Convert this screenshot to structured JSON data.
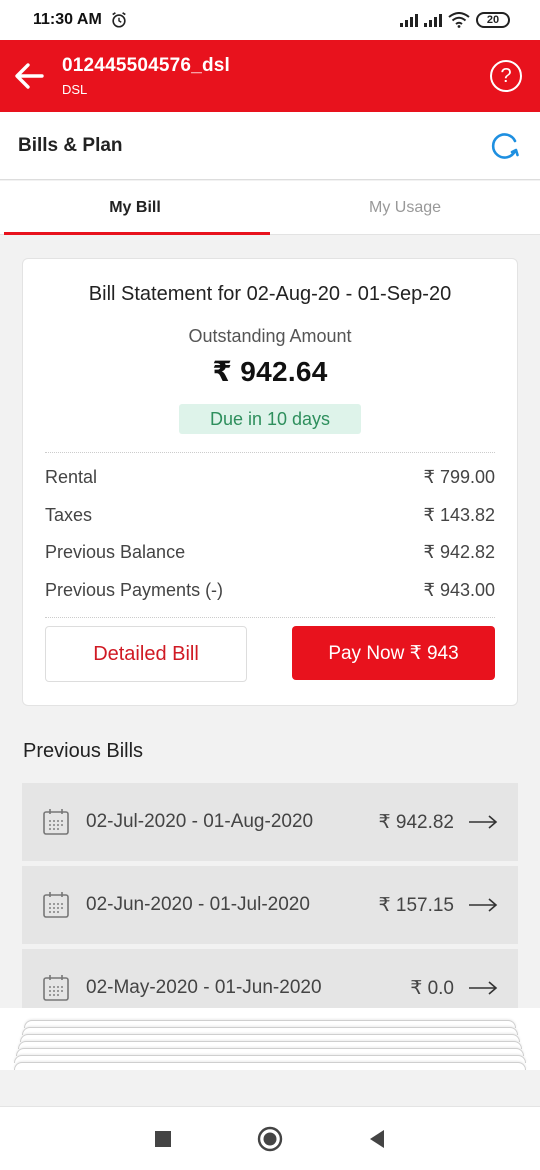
{
  "status_bar": {
    "time": "11:30 AM",
    "battery": "20"
  },
  "header": {
    "title": "012445504576_dsl",
    "subtitle": "DSL",
    "help_symbol": "?"
  },
  "section": {
    "title": "Bills & Plan"
  },
  "tabs": [
    {
      "label": "My Bill",
      "active": true
    },
    {
      "label": "My Usage",
      "active": false
    }
  ],
  "bill_card": {
    "statement": "Bill Statement for 02-Aug-20 - 01-Sep-20",
    "outstanding_label": "Outstanding Amount",
    "outstanding_amount": "₹ 942.64",
    "due_badge": "Due in 10 days",
    "rows": [
      {
        "label": "Rental",
        "value": "₹ 799.00"
      },
      {
        "label": "Taxes",
        "value": "₹ 143.82"
      },
      {
        "label": "Previous Balance",
        "value": "₹ 942.82"
      },
      {
        "label": "Previous Payments (-)",
        "value": "₹ 943.00"
      }
    ],
    "detailed_bill_label": "Detailed Bill",
    "pay_now_label": "Pay Now ₹ 943"
  },
  "previous_bills": {
    "title": "Previous Bills",
    "items": [
      {
        "range": "02-Jul-2020 - 01-Aug-2020",
        "amount": "₹ 942.82"
      },
      {
        "range": "02-Jun-2020 - 01-Jul-2020",
        "amount": "₹ 157.15"
      },
      {
        "range": "02-May-2020 - 01-Jun-2020",
        "amount": "₹ 0.0"
      }
    ]
  },
  "colors": {
    "brand_red": "#e8121d",
    "due_green": "#2e8f5d",
    "due_bg": "#def3ea",
    "refresh_blue": "#1e8fe0"
  },
  "icons": [
    "alarm-icon",
    "signal-icon",
    "wifi-icon",
    "battery-icon",
    "back-arrow-icon",
    "help-icon",
    "refresh-icon",
    "calendar-icon",
    "arrow-right-icon",
    "stop-icon",
    "home-icon",
    "back-triangle-icon"
  ]
}
